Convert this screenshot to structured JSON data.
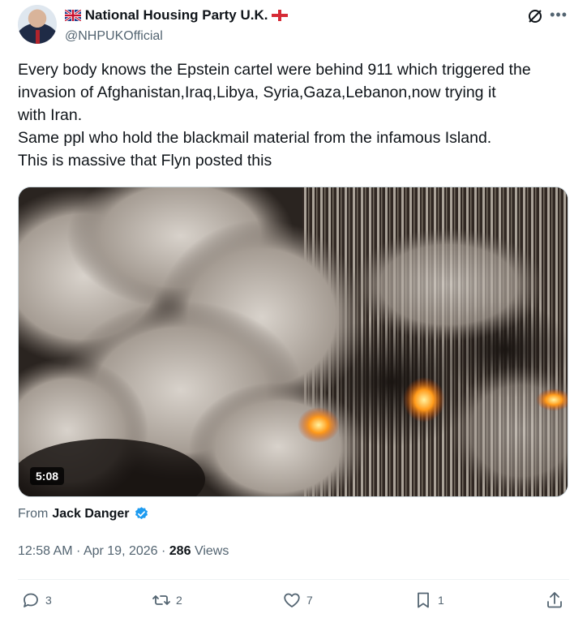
{
  "post": {
    "author": {
      "display_name": "National Housing Party U.K.",
      "handle": "@NHPUKOfficial",
      "flag_left": "uk-flag-icon",
      "flag_right": "england-flag-icon"
    },
    "text_lines": [
      "Every body knows the Epstein cartel were behind 911 which triggered the",
      "invasion of Afghanistan,Iraq,Libya, Syria,Gaza,Lebanon,now trying it",
      "with Iran.",
      "Same ppl who hold the blackmail material from the infamous Island.",
      "This is massive that Flyn posted this"
    ],
    "media": {
      "type": "video",
      "duration": "5:08"
    },
    "from": {
      "prefix": "From",
      "author": "Jack Danger",
      "verified": true
    },
    "timestamp": "12:58 AM · Apr 19, 2026",
    "separator": " · ",
    "views_count": "286",
    "views_label": "Views"
  },
  "actions": {
    "replies": "3",
    "reposts": "2",
    "likes": "7",
    "bookmarks": "1"
  },
  "colors": {
    "text_primary": "#0f1419",
    "text_secondary": "#536471",
    "verified_blue": "#1d9bf0",
    "divider": "#eff3f4"
  }
}
